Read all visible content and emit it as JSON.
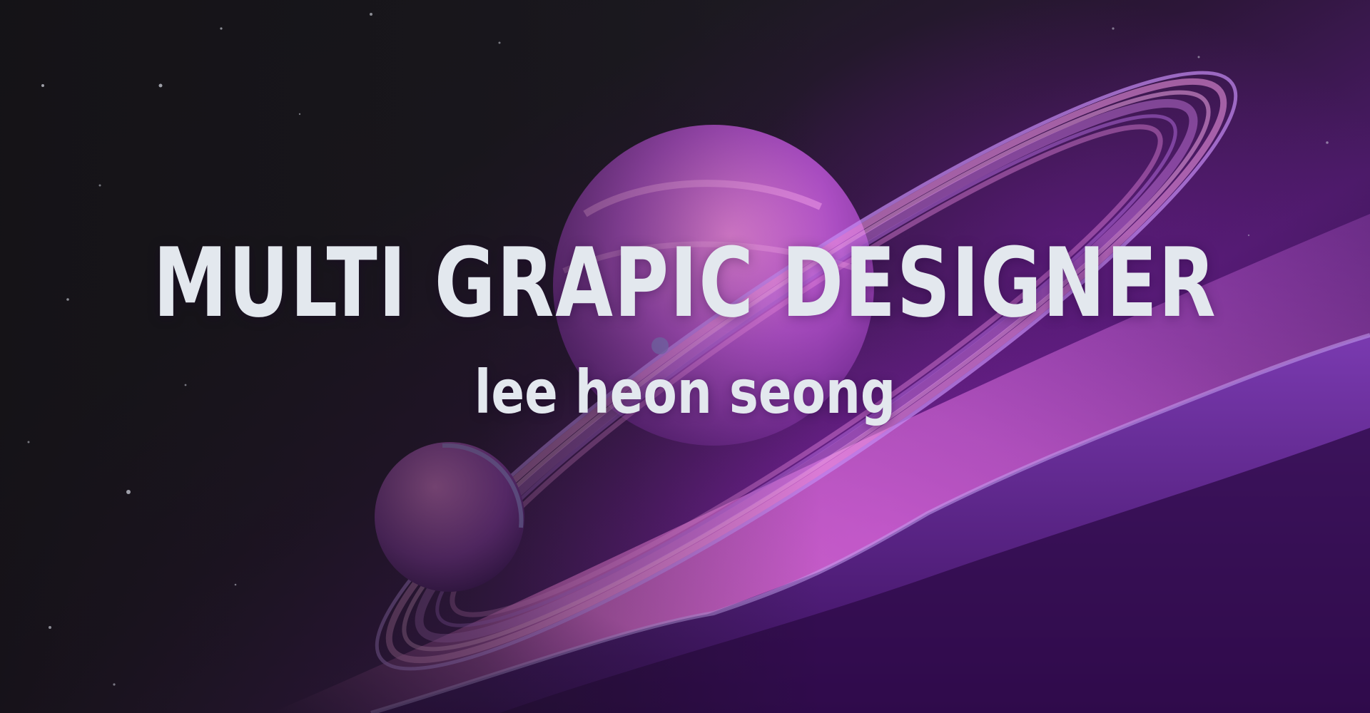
{
  "hero": {
    "headline": "MULTI GRAPIC DESIGNER",
    "subtitle": "lee heon seong"
  },
  "colors": {
    "text": "#e3e8ee",
    "space_dark": "#1a1a1f",
    "purple_deep": "#3a1058",
    "magenta_glow": "#e86ad8",
    "lavender": "#b38cf0"
  },
  "background_art": {
    "description_icons": [
      "ringed-planet-icon",
      "small-moon-icon",
      "mountain-ridge-icon",
      "starfield-icon"
    ]
  }
}
